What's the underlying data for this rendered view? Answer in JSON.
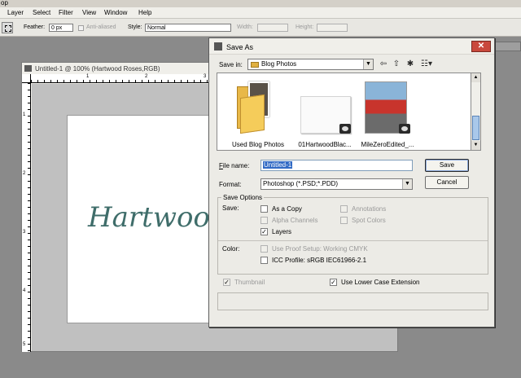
{
  "app": {
    "title_fragment": "op"
  },
  "menubar": {
    "items": [
      "Layer",
      "Select",
      "Filter",
      "View",
      "Window",
      "Help"
    ]
  },
  "options_bar": {
    "feather_label": "Feather:",
    "feather_value": "0 px",
    "antialiased_label": "Anti-aliased",
    "style_label": "Style:",
    "style_value": "Normal",
    "width_label": "Width:",
    "height_label": "Height:"
  },
  "document": {
    "title": "Untitled-1 @ 100% (Hartwood Roses,RGB)",
    "canvas_text": "Hartwood",
    "text_color": "#3f6d6a",
    "ruler_v": [
      "1",
      "2",
      "3",
      "4",
      "5"
    ],
    "ruler_h": [
      "1",
      "2",
      "3"
    ]
  },
  "dialog": {
    "title": "Save As",
    "close_glyph": "✕",
    "save_in_label": "Save in:",
    "save_in_value": "Blog Photos",
    "files": [
      {
        "name": "Used Blog Photos",
        "icon": "folder-icon"
      },
      {
        "name": "01HartwoodBlac...",
        "icon": "image-thumbnail-icon"
      },
      {
        "name": "MileZeroEdited_...",
        "icon": "image-thumbnail-icon"
      }
    ],
    "file_name_label": "File name:",
    "file_name_value": "Untitled-1",
    "format_label": "Format:",
    "format_value": "Photoshop (*.PSD;*.PDD)",
    "save_button": "Save",
    "cancel_button": "Cancel",
    "save_options": {
      "legend": "Save Options",
      "save_label": "Save:",
      "as_a_copy": "As a Copy",
      "alpha_channels": "Alpha Channels",
      "layers": "Layers",
      "annotations": "Annotations",
      "spot_colors": "Spot Colors",
      "color_label": "Color:",
      "use_proof_setup": "Use Proof Setup:  Working CMYK",
      "icc_profile": "ICC Profile:  sRGB IEC61966-2.1"
    },
    "thumbnail": "Thumbnail",
    "lower_case_ext": "Use Lower Case Extension",
    "check_glyph": "✓"
  }
}
